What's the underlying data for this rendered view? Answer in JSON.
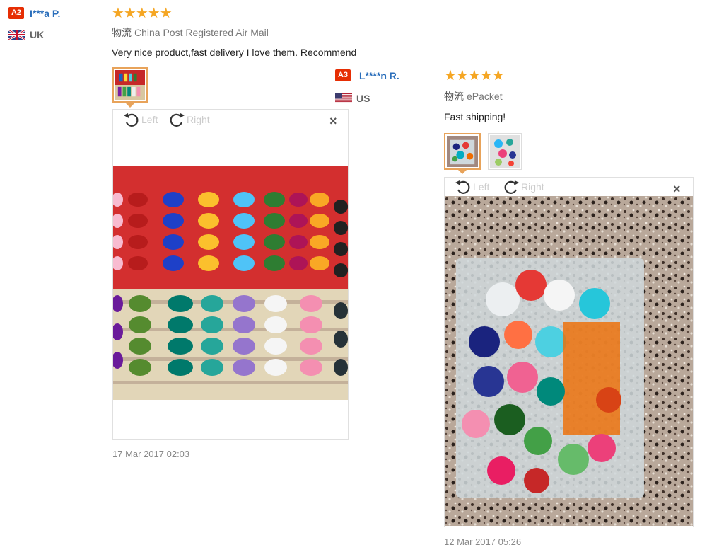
{
  "reviews": [
    {
      "badge": "A2",
      "user": "I***a P.",
      "country": "UK",
      "stars": "★★★★★",
      "logistics_label": "物流",
      "logistics": "China Post Registered Air Mail",
      "text": "Very nice product,fast delivery I love them. Recommend",
      "viewer": {
        "left": "Left",
        "right": "Right",
        "close": "×"
      },
      "date": "17 Mar 2017 02:03"
    },
    {
      "badge": "A3",
      "user": "L****n R.",
      "country": "US",
      "stars": "★★★★★",
      "logistics_label": "物流",
      "logistics": "ePacket",
      "text": "Fast shipping!",
      "viewer": {
        "left": "Left",
        "right": "Right",
        "close": "×"
      },
      "date": "12 Mar 2017 05:26"
    }
  ],
  "colors": {
    "badge": "#e62e04",
    "username": "#2a6ebb",
    "stars": "#f5a623",
    "active_thumb_border": "#e8a35a"
  }
}
